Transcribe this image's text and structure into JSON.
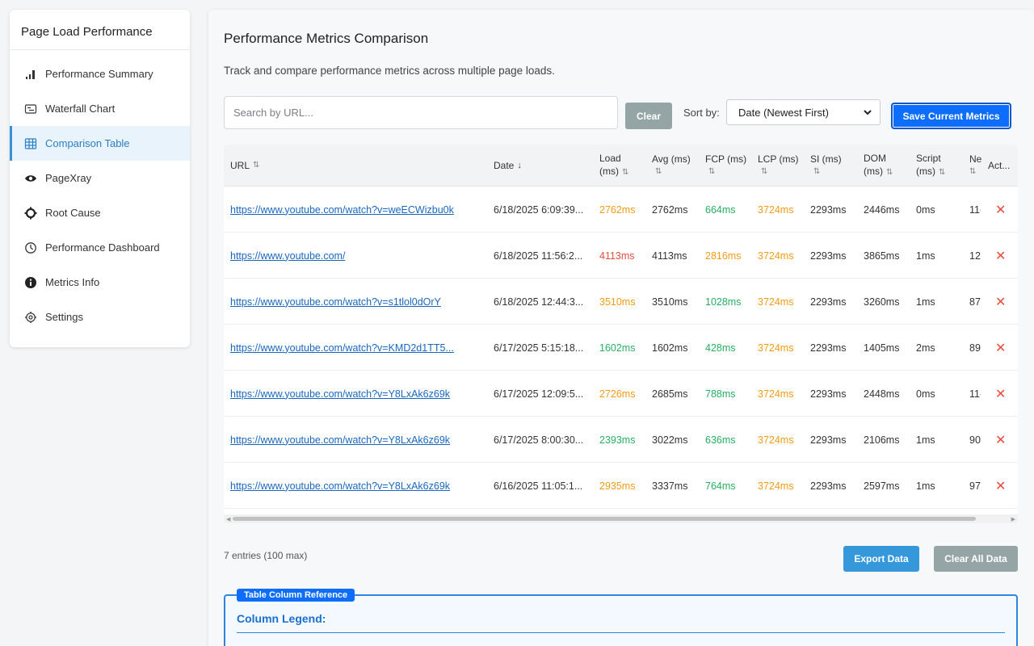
{
  "sidebar": {
    "title": "Page Load Performance",
    "items": [
      {
        "label": "Performance Summary",
        "icon": "bar-chart-icon"
      },
      {
        "label": "Waterfall Chart",
        "icon": "waterfall-icon"
      },
      {
        "label": "Comparison Table",
        "icon": "table-icon",
        "active": true
      },
      {
        "label": "PageXray",
        "icon": "eye-icon"
      },
      {
        "label": "Root Cause",
        "icon": "gear-icon"
      },
      {
        "label": "Performance Dashboard",
        "icon": "clock-icon"
      },
      {
        "label": "Metrics Info",
        "icon": "info-icon"
      },
      {
        "label": "Settings",
        "icon": "settings-icon"
      }
    ]
  },
  "main": {
    "title": "Performance Metrics Comparison",
    "description": "Track and compare performance metrics across multiple page loads.",
    "search_placeholder": "Search by URL...",
    "clear_label": "Clear",
    "sort_label": "Sort by:",
    "sort_value": "Date (Newest First)",
    "save_label": "Save Current Metrics"
  },
  "table": {
    "headers": {
      "url": "URL",
      "date": "Date",
      "load_1": "Load",
      "load_2": "(ms)",
      "avg": "Avg (ms)",
      "fcp": "FCP (ms)",
      "lcp": "LCP (ms)",
      "si": "SI (ms)",
      "dom_1": "DOM",
      "dom_2": "(ms)",
      "script_1": "Script",
      "script_2": "(ms)",
      "net": "Ne",
      "actions": "Act..."
    },
    "rows": [
      {
        "url": "https://www.youtube.com/watch?v=weECWizbu0k",
        "date": "6/18/2025 6:09:39...",
        "load": "2762ms",
        "load_color": "orange",
        "avg": "2762ms",
        "fcp": "664ms",
        "fcp_color": "green",
        "lcp": "3724ms",
        "si": "2293ms",
        "dom": "2446ms",
        "script": "0ms",
        "net": "11("
      },
      {
        "url": "https://www.youtube.com/",
        "date": "6/18/2025 11:56:2...",
        "load": "4113ms",
        "load_color": "red",
        "avg": "4113ms",
        "fcp": "2816ms",
        "fcp_color": "orange",
        "lcp": "3724ms",
        "si": "2293ms",
        "dom": "3865ms",
        "script": "1ms",
        "net": "12"
      },
      {
        "url": "https://www.youtube.com/watch?v=s1tlol0dOrY",
        "date": "6/18/2025 12:44:3...",
        "load": "3510ms",
        "load_color": "orange",
        "avg": "3510ms",
        "fcp": "1028ms",
        "fcp_color": "green",
        "lcp": "3724ms",
        "si": "2293ms",
        "dom": "3260ms",
        "script": "1ms",
        "net": "87("
      },
      {
        "url": "https://www.youtube.com/watch?v=KMD2d1TT5...",
        "date": "6/17/2025 5:15:18...",
        "load": "1602ms",
        "load_color": "green",
        "avg": "1602ms",
        "fcp": "428ms",
        "fcp_color": "green",
        "lcp": "3724ms",
        "si": "2293ms",
        "dom": "1405ms",
        "script": "2ms",
        "net": "89:"
      },
      {
        "url": "https://www.youtube.com/watch?v=Y8LxAk6z69k",
        "date": "6/17/2025 12:09:5...",
        "load": "2726ms",
        "load_color": "orange",
        "avg": "2685ms",
        "fcp": "788ms",
        "fcp_color": "green",
        "lcp": "3724ms",
        "si": "2293ms",
        "dom": "2448ms",
        "script": "0ms",
        "net": "11-"
      },
      {
        "url": "https://www.youtube.com/watch?v=Y8LxAk6z69k",
        "date": "6/17/2025 8:00:30...",
        "load": "2393ms",
        "load_color": "green",
        "avg": "3022ms",
        "fcp": "636ms",
        "fcp_color": "green",
        "lcp": "3724ms",
        "si": "2293ms",
        "dom": "2106ms",
        "script": "1ms",
        "net": "90-"
      },
      {
        "url": "https://www.youtube.com/watch?v=Y8LxAk6z69k",
        "date": "6/16/2025 11:05:1...",
        "load": "2935ms",
        "load_color": "orange",
        "avg": "3337ms",
        "fcp": "764ms",
        "fcp_color": "green",
        "lcp": "3724ms",
        "si": "2293ms",
        "dom": "2597ms",
        "script": "1ms",
        "net": "97"
      }
    ],
    "lcp_color": "orange"
  },
  "footer": {
    "entries": "7 entries (100 max)",
    "export_label": "Export Data",
    "clear_all_label": "Clear All Data"
  },
  "legend": {
    "tag": "Table Column Reference",
    "title": "Column Legend:"
  },
  "colors": {
    "accent": "#0d6efd",
    "orange": "#f39c12",
    "red": "#e74c3c",
    "green": "#27ae60"
  }
}
